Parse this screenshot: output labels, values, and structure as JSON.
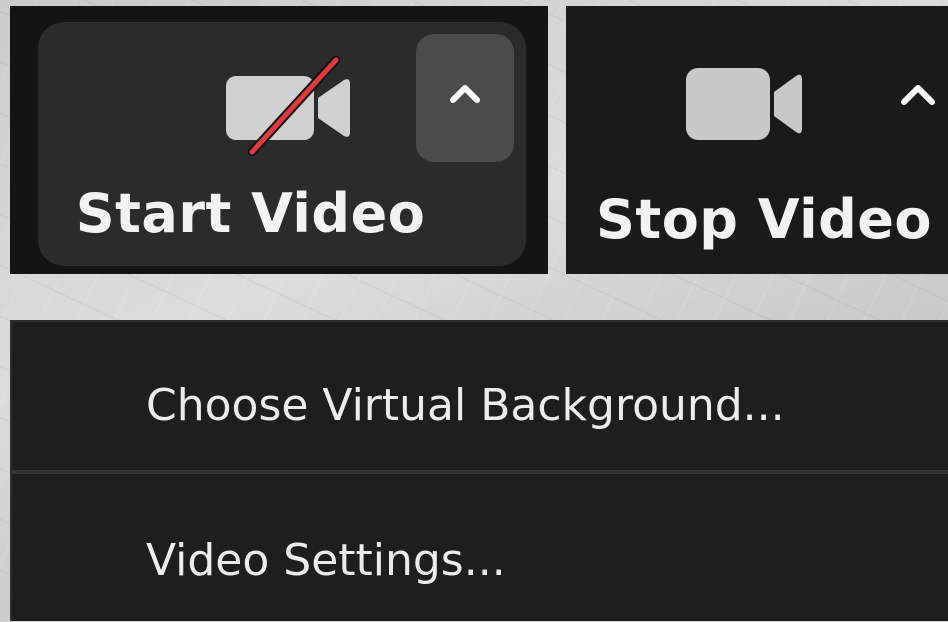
{
  "start_video": {
    "label": "Start Video",
    "icon": "camera-off-icon",
    "caret_icon": "chevron-up-icon"
  },
  "stop_video": {
    "label": "Stop Video",
    "icon": "camera-icon",
    "caret_icon": "chevron-up-icon"
  },
  "menu": {
    "items": [
      {
        "label": "Choose Virtual Background..."
      },
      {
        "label": "Video Settings..."
      }
    ]
  },
  "colors": {
    "slash_red": "#e03a3e",
    "icon_gray": "#d0d0d0",
    "panel_dark": "#1a1a1a",
    "button_bg": "#2b2b2b"
  }
}
